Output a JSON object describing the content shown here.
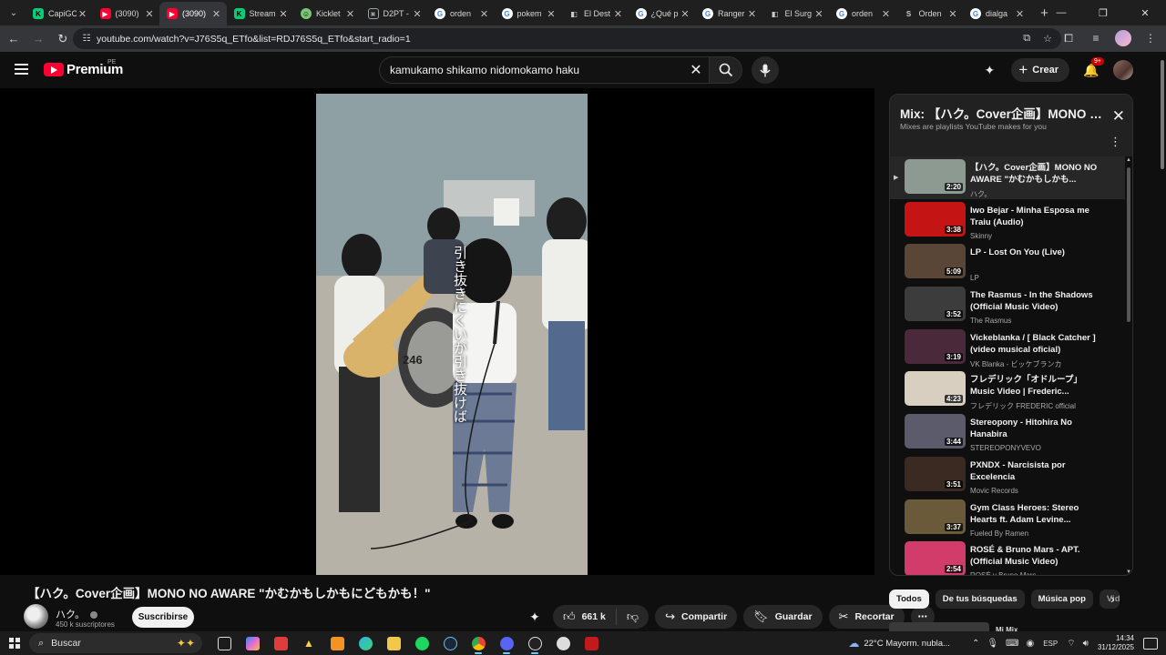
{
  "browser": {
    "tabs": [
      {
        "title": "CapiGC",
        "favicon": "kick-icon",
        "active": false
      },
      {
        "title": "(3090)",
        "favicon": "youtube-icon",
        "active": false
      },
      {
        "title": "(3090)",
        "favicon": "youtube-icon",
        "active": true
      },
      {
        "title": "Stream",
        "favicon": "kick-icon",
        "active": false
      },
      {
        "title": "Kicklet",
        "favicon": "kicklet-icon",
        "active": false
      },
      {
        "title": "D2PT -",
        "favicon": "d2pt-icon",
        "active": false
      },
      {
        "title": "orden",
        "favicon": "google-icon",
        "active": false
      },
      {
        "title": "pokem",
        "favicon": "google-icon",
        "active": false
      },
      {
        "title": "El Dest",
        "favicon": "page-icon",
        "active": false
      },
      {
        "title": "¿Qué p",
        "favicon": "google-icon",
        "active": false
      },
      {
        "title": "Ranger",
        "favicon": "google-icon",
        "active": false
      },
      {
        "title": "El Surg",
        "favicon": "page-icon",
        "active": false
      },
      {
        "title": "orden",
        "favicon": "google-icon",
        "active": false
      },
      {
        "title": "Orden",
        "favicon": "page-icon",
        "active": false
      },
      {
        "title": "dialga",
        "favicon": "google-icon",
        "active": false
      }
    ],
    "url": "youtube.com/watch?v=J76S5q_ETfo&list=RDJ76S5q_ETfo&start_radio=1"
  },
  "yt": {
    "logo_text": "Premium",
    "country_code": "PE",
    "search_query": "kamukamo shikamo nidomokamo haku",
    "create_label": "Crear",
    "notif_badge": "9+"
  },
  "video": {
    "title": "【ハク。Cover企画】MONO NO AWARE \"かむかもしかもにどもかも！\"",
    "subtitle_text": "引き抜きにくいが引き抜けば",
    "channel": "ハク。",
    "subscribers": "450 k suscriptores",
    "subscribe_label": "Suscribirse",
    "likes": "661 k",
    "share_label": "Compartir",
    "save_label": "Guardar",
    "clip_label": "Recortar"
  },
  "playlist": {
    "title": "Mix: 【ハク。Cover企画】MONO NO AWARE \"かむかもしかもにどもかも！\"",
    "subtitle": "Mixes are playlists YouTube makes for you",
    "items": [
      {
        "title": "【ハク。Cover企画】MONO NO AWARE \"かむかもしかも...",
        "channel": "ハク。",
        "duration": "2:20",
        "playing": true,
        "color": "#8d9a92"
      },
      {
        "title": "Iwo Bejar - Minha Esposa me Traiu (Audio)",
        "channel": "Skinny",
        "duration": "3:38",
        "playing": false,
        "color": "#c41414"
      },
      {
        "title": "LP - Lost On You (Live)",
        "channel": "LP",
        "duration": "5:09",
        "playing": false,
        "color": "#5a4636"
      },
      {
        "title": "The Rasmus - In the Shadows (Official Music Video)",
        "channel": "The Rasmus",
        "duration": "3:52",
        "playing": false,
        "color": "#3c3c3c"
      },
      {
        "title": "Vickeblanka / [ Black Catcher ] (video musical oficial)",
        "channel": "VK Blanka - ビッケブランカ",
        "duration": "3:19",
        "playing": false,
        "color": "#4a2a3a"
      },
      {
        "title": "フレデリック「オドループ」Music Video | Frederic...",
        "channel": "フレデリック FREDERIC official",
        "duration": "4:23",
        "playing": false,
        "color": "#d8cfc0"
      },
      {
        "title": "Stereopony - Hitohira No Hanabira",
        "channel": "STEREOPONYVEVO",
        "duration": "3:44",
        "playing": false,
        "color": "#5b5b6b"
      },
      {
        "title": "PXNDX - Narcisista por Excelencia",
        "channel": "Movic Records",
        "duration": "3:51",
        "playing": false,
        "color": "#3a2a22"
      },
      {
        "title": "Gym Class Heroes: Stereo Hearts ft. Adam Levine...",
        "channel": "Fueled By Ramen",
        "duration": "3:37",
        "playing": false,
        "color": "#6b5a3a"
      },
      {
        "title": "ROSÉ & Bruno Mars - APT. (Official Music Video)",
        "channel": "ROSÉ y Bruno Mars",
        "duration": "2:54",
        "playing": false,
        "color": "#d23c6a"
      }
    ]
  },
  "chips": [
    "Todos",
    "De tus búsquedas",
    "Música pop",
    "Vid"
  ],
  "next_video_peek": "Mi Mix",
  "taskbar": {
    "search_placeholder": "Buscar",
    "weather": "22°C  Mayorm. nubla...",
    "lang": "ESP",
    "time": "14:34",
    "date": "31/12/2025"
  }
}
